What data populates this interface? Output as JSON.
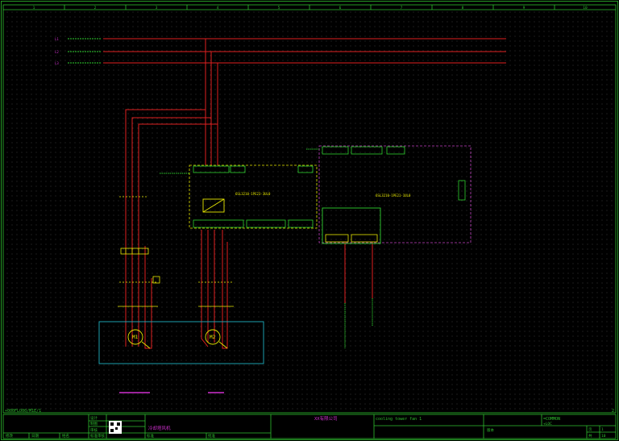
{
  "colors": {
    "background": "#000000",
    "frame": "#2fbf2f",
    "grid_dot": "#3a3a3a",
    "power_line": "#e02020",
    "control_line": "#e02020",
    "component": "#e8e800",
    "enclosure_green": "#2fd02f",
    "enclosure_magenta": "#c040c0",
    "motor_box": "#20b0c0",
    "magenta_label": "#d030d0",
    "white": "#ffffff"
  },
  "frame": {
    "column_numbers": [
      "1",
      "2",
      "3",
      "4",
      "5",
      "6",
      "7",
      "8",
      "9",
      "10"
    ]
  },
  "drawing": {
    "sheet_id": "+000FLO00/M1E/1",
    "page_marker": "2"
  },
  "title_block": {
    "labels": {
      "designed": "设计",
      "checked": "审核",
      "approved": "批准",
      "revised": "修改",
      "date": "日期",
      "name": "姓名",
      "standard": "标准",
      "standard_check": "标准审核",
      "drawn": "制图",
      "rev_no": "版本"
    },
    "drawing_title": "冷却塔风机",
    "company": "XX有限公司",
    "project": "cooling tower fan 1",
    "equipment": "=COMMON",
    "location": "+LOC",
    "page_label": "页",
    "total_label": "共",
    "page_no": "1",
    "total_no": "10"
  },
  "components": {
    "incoming": [
      "L1",
      "L2",
      "L3"
    ],
    "vfd_main": "6SL3210-1PE23-3UL0",
    "vfd_aux": "6SL3210-1PE21-1UL0",
    "motor1": "M1",
    "motor2": "M2"
  }
}
